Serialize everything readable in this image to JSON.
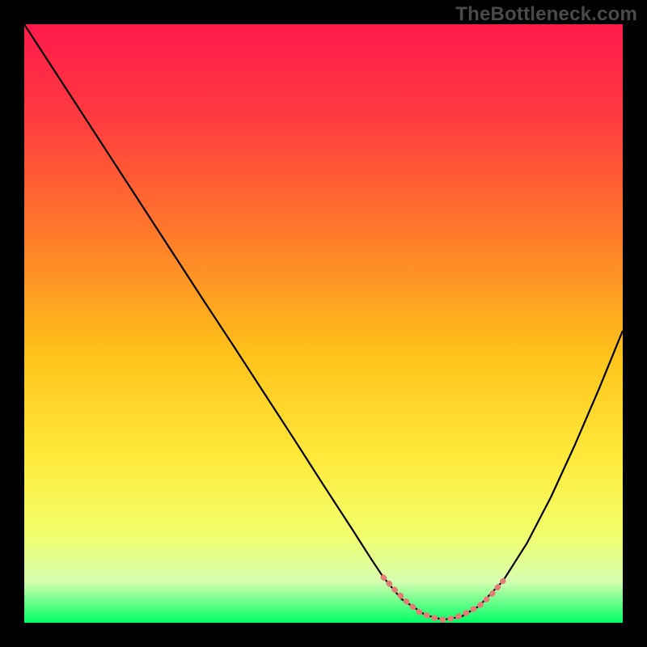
{
  "watermark": "TheBottleneck.com",
  "chart_data": {
    "type": "line",
    "title": "",
    "xlabel": "",
    "ylabel": "",
    "xlim": [
      0,
      100
    ],
    "ylim": [
      0,
      100
    ],
    "grid": false,
    "legend": false,
    "background_gradient": {
      "stops": [
        {
          "offset": 0.0,
          "color": "#ff1a4b"
        },
        {
          "offset": 0.15,
          "color": "#ff3940"
        },
        {
          "offset": 0.35,
          "color": "#ff7a2a"
        },
        {
          "offset": 0.55,
          "color": "#ffc21a"
        },
        {
          "offset": 0.72,
          "color": "#ffe93a"
        },
        {
          "offset": 0.85,
          "color": "#f3ff6a"
        },
        {
          "offset": 0.93,
          "color": "#d8ffb0"
        },
        {
          "offset": 1.0,
          "color": "#00ff66"
        }
      ]
    },
    "series": [
      {
        "name": "curve",
        "color": "#000000",
        "stroke_width": 2.2,
        "x": [
          0,
          5,
          10,
          15,
          20,
          25,
          30,
          35,
          40,
          45,
          50,
          55,
          58,
          60,
          63,
          67,
          70,
          73,
          76,
          80,
          84,
          88,
          92,
          96,
          100
        ],
        "y": [
          100,
          92.3,
          84.6,
          76.9,
          69.2,
          61.5,
          53.8,
          46.2,
          38.5,
          30.8,
          23,
          15.3,
          10.6,
          7.6,
          4,
          1.3,
          0.5,
          1,
          2.8,
          7,
          13.3,
          21,
          29.7,
          39,
          48.8
        ]
      },
      {
        "name": "valley-highlight",
        "color": "#e47c78",
        "stroke_width": 7,
        "dash": "1.2 9",
        "linecap": "round",
        "x": [
          60,
          62,
          64,
          66,
          68,
          70,
          72,
          74,
          76,
          78,
          80
        ],
        "y": [
          7.6,
          5.4,
          3.4,
          1.8,
          0.9,
          0.5,
          0.8,
          1.7,
          2.8,
          4.6,
          7
        ]
      }
    ]
  }
}
